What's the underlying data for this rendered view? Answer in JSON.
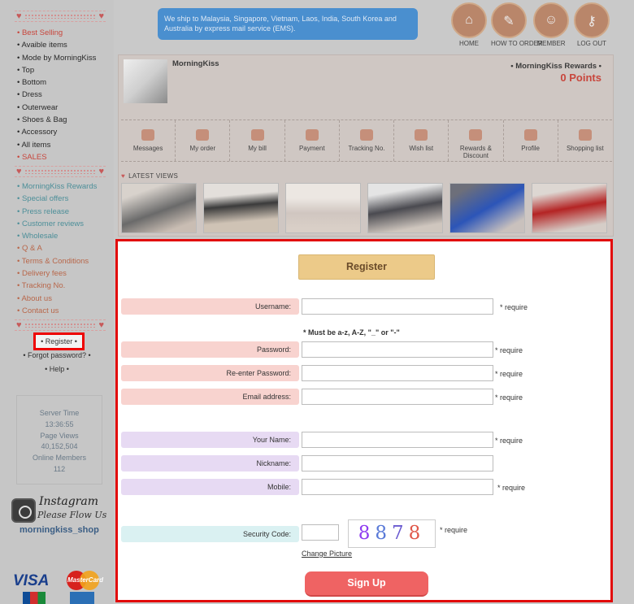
{
  "sidebar": {
    "menu1": [
      {
        "label": "Best Selling",
        "tone": "red"
      },
      {
        "label": "Avaible items",
        "tone": "dark"
      },
      {
        "label": "Mode by MorningKiss",
        "tone": "dark"
      },
      {
        "label": "Top",
        "tone": "dark"
      },
      {
        "label": "Bottom",
        "tone": "dark"
      },
      {
        "label": "Dress",
        "tone": "dark"
      },
      {
        "label": "Outerwear",
        "tone": "dark"
      },
      {
        "label": "Shoes & Bag",
        "tone": "dark"
      },
      {
        "label": "Accessory",
        "tone": "dark"
      },
      {
        "label": "All items",
        "tone": "dark"
      },
      {
        "label": "SALES",
        "tone": "red"
      }
    ],
    "menu2": [
      {
        "label": "MorningKiss Rewards",
        "tone": "teal"
      },
      {
        "label": "Special offers",
        "tone": "teal"
      },
      {
        "label": "Press release",
        "tone": "teal"
      },
      {
        "label": "Customer reviews",
        "tone": "teal"
      },
      {
        "label": "Wholesale",
        "tone": "teal"
      },
      {
        "label": "Q & A",
        "tone": "orange"
      },
      {
        "label": "Terms & Conditions",
        "tone": "orange"
      },
      {
        "label": "Delivery fees",
        "tone": "orange"
      },
      {
        "label": "Tracking No.",
        "tone": "orange"
      },
      {
        "label": "About us",
        "tone": "orange"
      },
      {
        "label": "Contact us",
        "tone": "orange"
      }
    ],
    "register": "• Register •",
    "forgot": "• Forgot password? •",
    "help": "• Help •",
    "server": {
      "time_label": "Server Time",
      "time": "13:36:55",
      "views_label": "Page Views",
      "views": "40,152,504",
      "members_label": "Online Members",
      "members": "112"
    },
    "instagram": {
      "title": "Instagram",
      "sub": "Please Flow Us",
      "handle": "morningkiss_shop"
    },
    "cards": {
      "visa": "VISA",
      "mastercard": "MasterCard"
    }
  },
  "header": {
    "shipping": "We ship to Malaysia, Singapore, Vietnam, Laos, India, South Korea and Australia by express mail service (EMS).",
    "nav": [
      {
        "label": "HOME",
        "icon": "home-icon"
      },
      {
        "label": "HOW TO ORDER",
        "icon": "tag-icon"
      },
      {
        "label": "MEMBER",
        "icon": "member-icon"
      },
      {
        "label": "LOG OUT",
        "icon": "key-icon"
      }
    ]
  },
  "profile": {
    "name": "MorningKiss",
    "rewards_label": "• MorningKiss Rewards •",
    "points": "0 Points",
    "menu": [
      "Messages",
      "My order",
      "My bill",
      "Payment",
      "Tracking No.",
      "Wish list",
      "Rewards & Discount",
      "Profile",
      "Shopping list"
    ],
    "latest_label": "LATEST VIEWS"
  },
  "form": {
    "title": "Register",
    "username_label": "Username:",
    "username_hint": "* Must be a-z, A-Z, \"_\" or \"-\"",
    "password_label": "Password:",
    "repassword_label": "Re-enter Password:",
    "email_label": "Email address:",
    "yourname_label": "Your Name:",
    "nickname_label": "Nickname:",
    "mobile_label": "Mobile:",
    "security_label": "Security Code:",
    "require": "* require",
    "captcha": [
      "8",
      "8",
      "7",
      "8"
    ],
    "change_picture": "Change Picture",
    "signup": "Sign Up"
  },
  "colors": {
    "panel_border": "#e20a0a",
    "signup": "#ef6363",
    "register_title": "#ecca89",
    "pink_label": "#f8d3cf",
    "lavender_label": "#e7daf3",
    "mint_label": "#daf1f2"
  }
}
